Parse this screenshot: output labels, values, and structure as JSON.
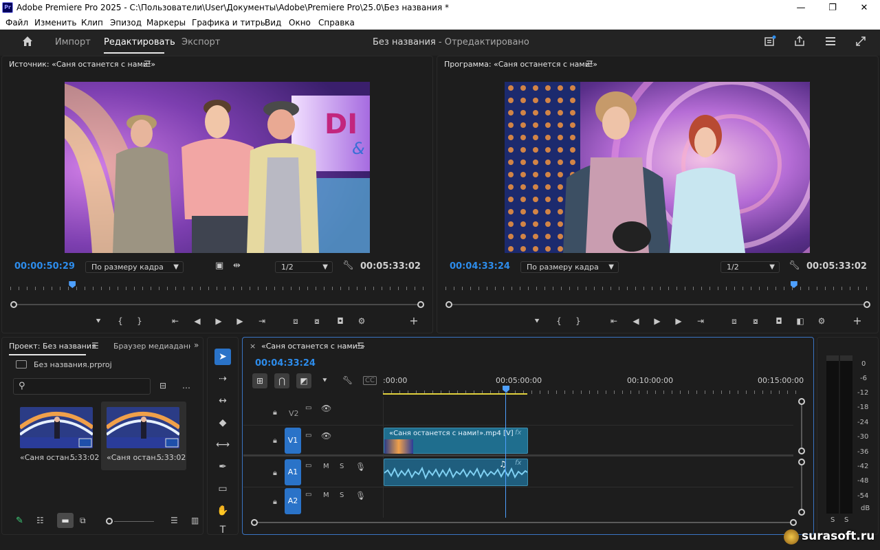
{
  "app": {
    "title": "Adobe Premiere Pro 2025 - C:\\Пользователи\\User\\Документы\\Adobe\\Premiere Pro\\25.0\\Без названия *",
    "logo_text": "Pr",
    "window_buttons": [
      "—",
      "❐",
      "✕"
    ]
  },
  "menu": [
    "Файл",
    "Изменить",
    "Клип",
    "Эпизод",
    "Маркеры",
    "Графика и титры",
    "Вид",
    "Окно",
    "Справка"
  ],
  "workspace": {
    "tabs": [
      "Импорт",
      "Редактировать",
      "Экспорт"
    ],
    "active_tab": "Редактировать",
    "doc_title": "Без названия",
    "doc_status": " - Отредактировано"
  },
  "source_monitor": {
    "title": "Источник: «Саня останется с нами!»",
    "timecode": "00:00:50:29",
    "zoom": "По размеру кадра",
    "resolution": "1/2",
    "duration": "00:05:33:02",
    "playhead_fraction": 0.15
  },
  "program_monitor": {
    "title": "Программа: «Саня останется с нами!»",
    "timecode": "00:04:33:24",
    "zoom": "По размеру кадра",
    "resolution": "1/2",
    "duration": "00:05:33:02",
    "playhead_fraction": 0.82
  },
  "project": {
    "tab_active": "Проект: Без названия",
    "tab_other": "Браузер медиаданных",
    "file": "Без названия.prproj",
    "search_placeholder": "",
    "items": [
      {
        "name": "«Саня остан...",
        "duration": "5:33:02"
      },
      {
        "name": "«Саня остан...",
        "duration": "5:33:02"
      }
    ]
  },
  "timeline": {
    "tab": "«Саня останется с нами!»",
    "close": "×",
    "timecode": "00:04:33:24",
    "ruler_labels": [
      ":00:00",
      "00:05:00:00",
      "00:10:00:00",
      "00:15:00:00"
    ],
    "tracks": [
      {
        "id": "V2",
        "kind": "video"
      },
      {
        "id": "V1",
        "kind": "video"
      },
      {
        "id": "A1",
        "kind": "audio"
      },
      {
        "id": "A2",
        "kind": "audio"
      }
    ],
    "clip_video": "«Саня останется с нами!».mp4 [V]",
    "fx": "fx",
    "audio_m": "M",
    "audio_s": "S"
  },
  "meter": {
    "labels": [
      "0",
      "-6",
      "-12",
      "-18",
      "-24",
      "-30",
      "-36",
      "-42",
      "-48",
      "-54",
      "dB"
    ],
    "solo": [
      "S",
      "S"
    ]
  },
  "watermark": "surasoft.ru",
  "colors": {
    "accent_blue": "#2d8ceb",
    "clip_video": "#1f6e8e",
    "clip_audio": "#1f5e7e",
    "in_out_yellow": "#e2d13c"
  }
}
